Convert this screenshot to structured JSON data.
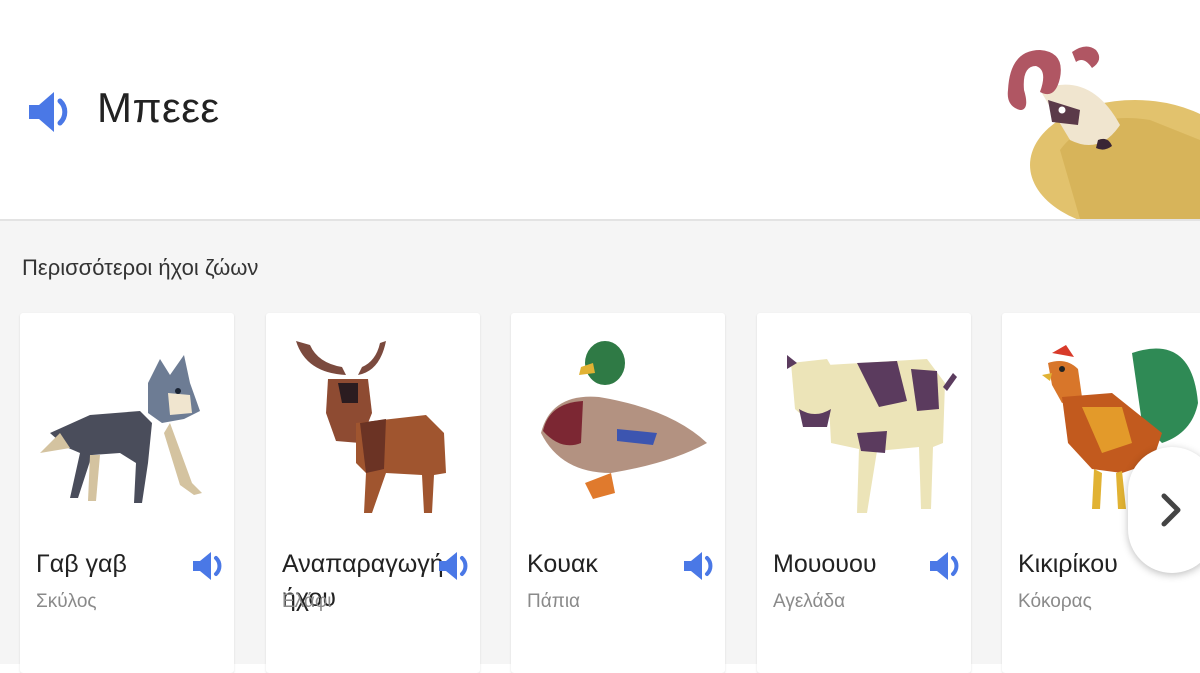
{
  "colors": {
    "accent": "#4a78e6",
    "background_more": "#f5f5f5"
  },
  "result": {
    "sound": "Μπεεε",
    "animal_icon": "ram-image"
  },
  "more": {
    "title": "Περισσότεροι ήχοι ζώων",
    "cards": [
      {
        "sound": "Γαβ γαβ",
        "animal": "Σκύλος",
        "image": "wolf-dog-image"
      },
      {
        "sound": "Αναπαραγωγή ήχου",
        "animal": "Ελάφι",
        "image": "moose-image"
      },
      {
        "sound": "Κουακ",
        "animal": "Πάπια",
        "image": "duck-image"
      },
      {
        "sound": "Μουουου",
        "animal": "Αγελάδα",
        "image": "cow-image"
      },
      {
        "sound": "Κικιρίκου",
        "animal": "Κόκορας",
        "image": "rooster-image"
      }
    ],
    "next_icon": "chevron-right-icon"
  }
}
